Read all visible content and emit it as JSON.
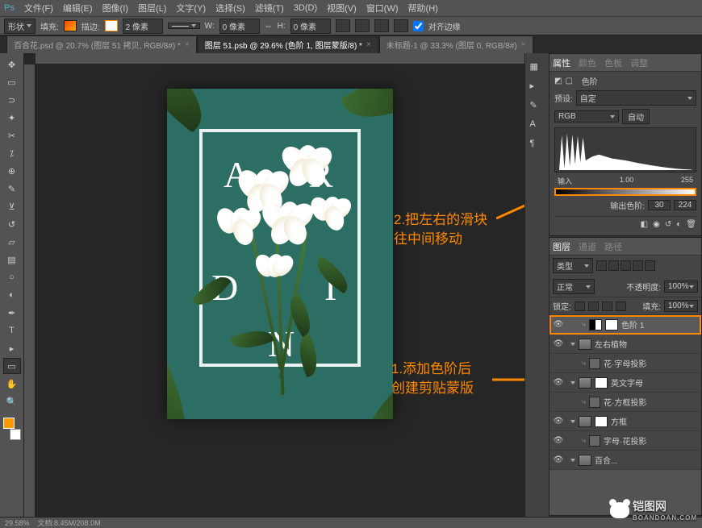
{
  "menu": [
    "文件(F)",
    "编辑(E)",
    "图像(I)",
    "图层(L)",
    "文字(Y)",
    "选择(S)",
    "滤镜(T)",
    "3D(D)",
    "视图(V)",
    "窗口(W)",
    "帮助(H)"
  ],
  "options": {
    "shape": "形状",
    "fill_label": "填充:",
    "stroke_label": "描边:",
    "stroke_width": "2 像素",
    "w_label": "W:",
    "w_val": "0 像素",
    "h_label": "H:",
    "h_val": "0 像素",
    "align_edges": "对齐边缘"
  },
  "tabs": [
    {
      "label": "百合花.psd @ 20.7% (图层 51 拷贝, RGB/8#) *",
      "active": false
    },
    {
      "label": "图层 51.psb @ 29.6% (色阶 1, 图层蒙版/8) *",
      "active": true
    },
    {
      "label": "未标题-1 @ 33.3% (图层 0, RGB/8#)",
      "active": false
    }
  ],
  "artboard_letters": [
    "A",
    "R",
    "D",
    "I",
    "N"
  ],
  "properties": {
    "tab1": "属性",
    "tab2": "颜色",
    "tab3": "色板",
    "tab4": "调整",
    "title": "色阶",
    "preset_label": "预设:",
    "preset_val": "自定",
    "channel": "RGB",
    "auto": "自动",
    "scale": [
      "输入",
      "1.00",
      "255"
    ],
    "output_label": "输出色阶:",
    "out_lo": "30",
    "out_hi": "224"
  },
  "layers_panel": {
    "tab1": "图层",
    "tab2": "通道",
    "tab3": "路径",
    "kind": "类型",
    "blend": "正常",
    "opacity_label": "不透明度:",
    "opacity": "100%",
    "lock_label": "锁定:",
    "fill_label": "填充:",
    "fill": "100%"
  },
  "layers": [
    {
      "sel": true,
      "eye": true,
      "indent": 14,
      "thumbs": [
        "adj",
        "mask"
      ],
      "name": "色阶 1",
      "clip": true
    },
    {
      "eye": true,
      "indent": 0,
      "thumbs": [
        "grp"
      ],
      "name": "左右植物",
      "folder": true
    },
    {
      "eye": false,
      "indent": 14,
      "thumbs": [
        "fold"
      ],
      "name": "花·字母投影",
      "clip": true
    },
    {
      "eye": true,
      "indent": 0,
      "thumbs": [
        "grp",
        "mask"
      ],
      "name": "英文字母",
      "folder": true
    },
    {
      "eye": false,
      "indent": 14,
      "thumbs": [
        "fold"
      ],
      "name": "花·方框投影",
      "clip": true
    },
    {
      "eye": true,
      "indent": 0,
      "thumbs": [
        "grp",
        "mask"
      ],
      "name": "方框",
      "folder": true
    },
    {
      "eye": true,
      "indent": 14,
      "thumbs": [
        "fold"
      ],
      "name": "字母·花投影",
      "clip": true
    },
    {
      "eye": true,
      "indent": 0,
      "thumbs": [
        "grp"
      ],
      "name": "百合...",
      "folder": true
    }
  ],
  "annotations": {
    "a1_l1": "1.添加色阶后",
    "a1_l2": "创建剪贴蒙版",
    "a2_l1": "2.把左右的滑块",
    "a2_l2": "往中间移动"
  },
  "status": {
    "zoom": "29.58%",
    "docinfo": "文档:8.45M/208.0M"
  },
  "watermark": {
    "name": "铠图网",
    "sub": "BOANDOAN.COM"
  }
}
